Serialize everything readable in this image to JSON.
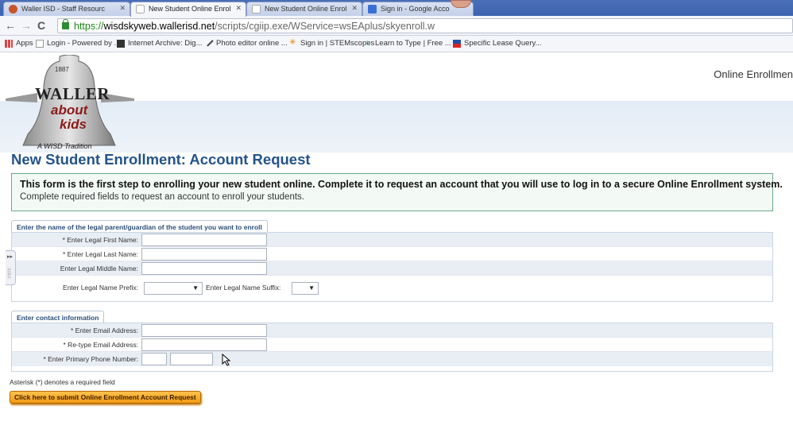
{
  "browser": {
    "tabs": [
      {
        "title": "Waller ISD - Staff Resourc",
        "active": false,
        "icon_color": "#c7542b"
      },
      {
        "title": "New Student Online Enrol",
        "active": true,
        "icon_color": "#ffffff"
      },
      {
        "title": "New Student Online Enrol",
        "active": false,
        "icon_color": "#ffffff"
      },
      {
        "title": "Sign in - Google Acco",
        "active": false,
        "icon_color": "#3b6fd8"
      }
    ],
    "url": {
      "protocol": "https://",
      "domain": "wisdskyweb.wallerisd.net",
      "path": "/scripts/cgiip.exe/WService=wsEAplus/skyenroll.w"
    },
    "bookmarks": [
      {
        "label": "Apps",
        "icon": "apps-grid-icon"
      },
      {
        "label": "Login - Powered by ...",
        "icon": "page-icon"
      },
      {
        "label": "Internet Archive: Dig...",
        "icon": "archive-icon"
      },
      {
        "label": "Photo editor online ...",
        "icon": "pen-icon"
      },
      {
        "label": "Sign in | STEMscopes",
        "icon": "star-icon"
      },
      {
        "label": "Learn to Type | Free ...",
        "icon": "keyboard-icon"
      },
      {
        "label": "Specific Lease Query...",
        "icon": "flag-icon"
      }
    ]
  },
  "header": {
    "logo": {
      "year": "1887",
      "name": "WALLER",
      "line1": "about",
      "line2": "kids",
      "tagline": "A WISD Tradition"
    },
    "system_title": "Online Enrollmen"
  },
  "page": {
    "title": "New Student Enrollment: Account Request",
    "intro_strong": "This form is the first step to enrolling your new student online. Complete it to request an account that you will use to log in to a secure Online Enrollment system.",
    "intro_sub": "Complete required fields to request an account to enroll your students."
  },
  "guardian_section": {
    "tab": "Enter the name of the legal parent/guardian of the student you want to enroll",
    "first_name_label": "* Enter Legal First Name:",
    "last_name_label": "* Enter Legal Last Name:",
    "middle_name_label": "Enter Legal Middle Name:",
    "prefix_label": "Enter Legal Name Prefix:",
    "suffix_label": "Enter Legal Name Suffix:",
    "first_name": "",
    "last_name": "",
    "middle_name": "",
    "prefix": "",
    "suffix": ""
  },
  "contact_section": {
    "tab": "Enter contact information",
    "email_label": "* Enter Email Address:",
    "retype_email_label": "* Re-type Email Address:",
    "phone_label": "* Enter Primary Phone Number:",
    "email": "",
    "retype_email": "",
    "phone_area": "",
    "phone_number": ""
  },
  "footer": {
    "required_note": "Asterisk (*) denotes a required field",
    "submit_label": "Click here to submit Online Enrollment Account Request"
  },
  "colors": {
    "title_blue": "#24538a",
    "submit_orange": "#f39a14",
    "intro_border": "#6aaa8a"
  }
}
